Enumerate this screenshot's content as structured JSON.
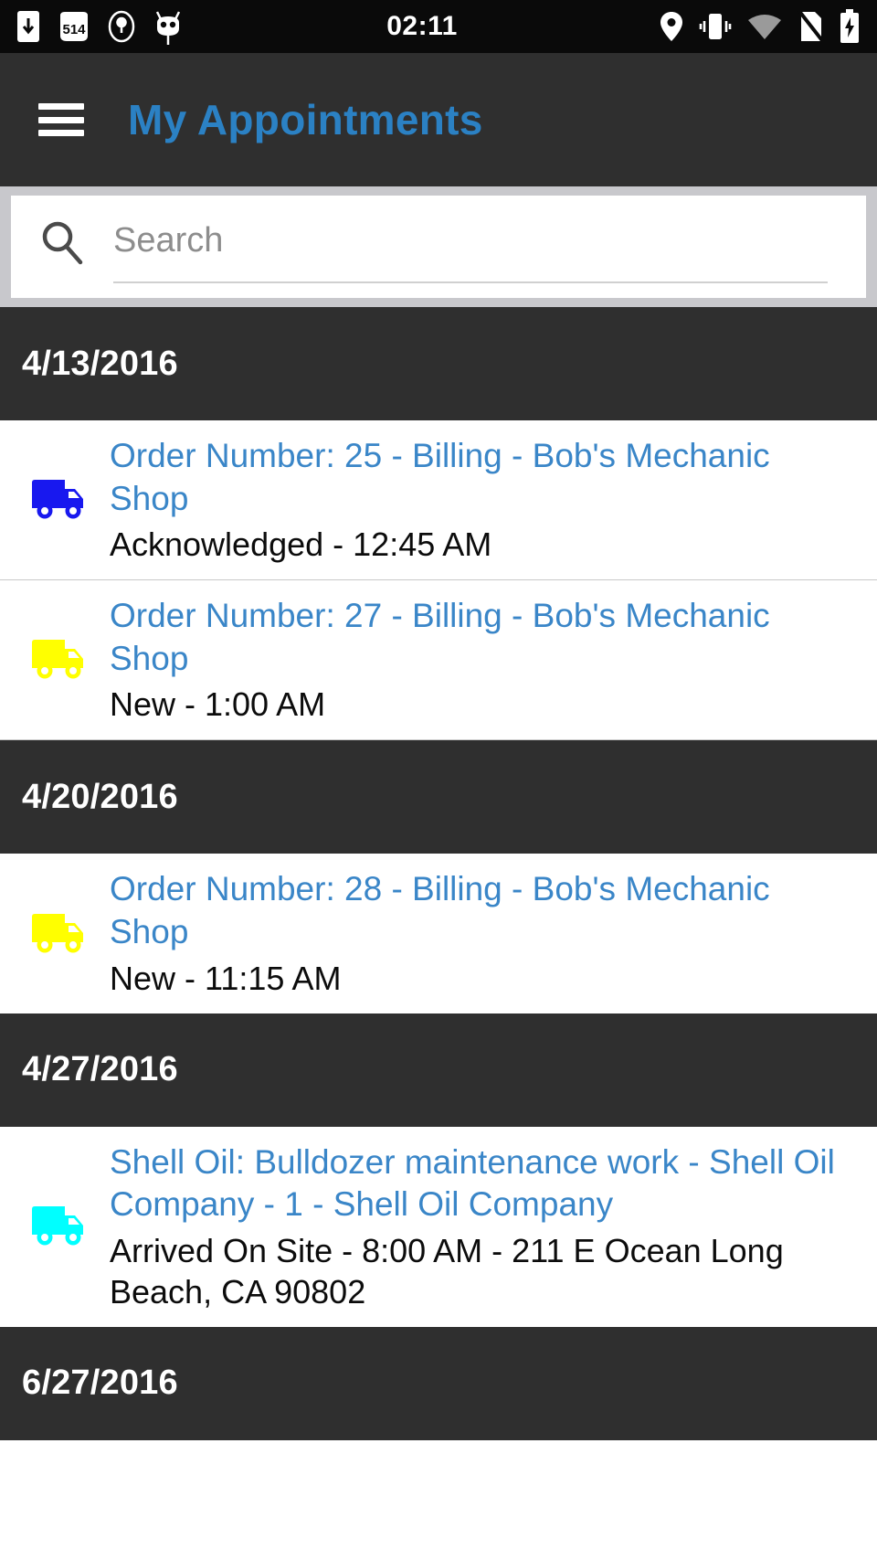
{
  "status_bar": {
    "clock": "02:11",
    "left_icons": [
      "download-phone-icon",
      "route-514-icon",
      "location-pin-badge-icon",
      "cyanogenmod-icon"
    ],
    "right_icons": [
      "location-icon",
      "vibrate-icon",
      "wifi-icon",
      "no-sim-icon",
      "battery-charging-icon"
    ]
  },
  "app_bar": {
    "menu_icon": "hamburger-menu-icon",
    "title": "My Appointments",
    "title_color": "#2b81c4"
  },
  "search": {
    "icon": "search-icon",
    "placeholder": "Search",
    "value": ""
  },
  "colors": {
    "header_bg": "#2f2f2f",
    "accent_blue": "#3a86c8",
    "truck_blue": "#1818ef",
    "truck_yellow": "#ffff00",
    "truck_cyan": "#00ffff"
  },
  "sections": [
    {
      "date": "4/13/2016",
      "items": [
        {
          "icon": "truck-icon",
          "icon_color": "#1818ef",
          "title": "Order Number: 25 - Billing - Bob's Mechanic Shop",
          "subtitle": "Acknowledged - 12:45 AM"
        },
        {
          "icon": "truck-icon",
          "icon_color": "#ffff00",
          "title": "Order Number: 27 - Billing - Bob's Mechanic Shop",
          "subtitle": "New - 1:00 AM"
        }
      ]
    },
    {
      "date": "4/20/2016",
      "items": [
        {
          "icon": "truck-icon",
          "icon_color": "#ffff00",
          "title": "Order Number: 28 - Billing - Bob's Mechanic Shop",
          "subtitle": "New - 11:15 AM"
        }
      ]
    },
    {
      "date": "4/27/2016",
      "items": [
        {
          "icon": "truck-icon",
          "icon_color": "#00ffff",
          "title": "Shell Oil: Bulldozer maintenance work - Shell Oil Company - 1 - Shell Oil Company",
          "subtitle": "Arrived On Site - 8:00 AM - 211 E Ocean Long Beach, CA 90802"
        }
      ]
    },
    {
      "date": "6/27/2016",
      "items": []
    }
  ]
}
